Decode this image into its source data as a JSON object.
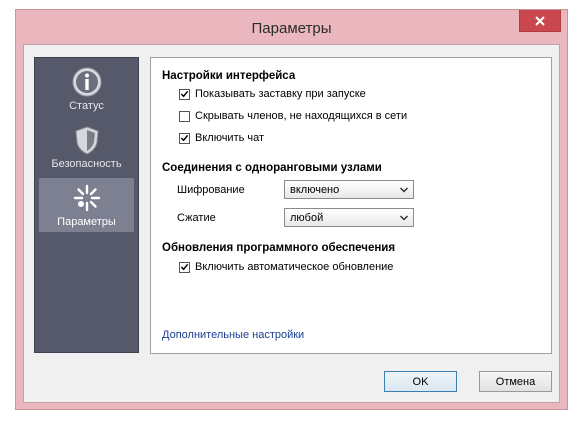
{
  "window": {
    "title": "Параметры"
  },
  "sidebar": {
    "items": [
      {
        "label": "Статус",
        "icon": "info-icon"
      },
      {
        "label": "Безопасность",
        "icon": "shield-icon"
      },
      {
        "label": "Параметры",
        "icon": "settings-icon",
        "active": true
      }
    ]
  },
  "interface": {
    "title": "Настройки интерфейса",
    "options": [
      {
        "label": "Показывать заставку при запуске",
        "checked": true
      },
      {
        "label": "Скрывать членов, не находящихся в сети",
        "checked": false
      },
      {
        "label": "Включить чат",
        "checked": true
      }
    ]
  },
  "peers": {
    "title": "Соединения с одноранговыми узлами",
    "encryption_label": "Шифрование",
    "encryption_value": "включено",
    "compression_label": "Сжатие",
    "compression_value": "любой"
  },
  "updates": {
    "title": "Обновления программного обеспечения",
    "auto_update_label": "Включить автоматическое обновление",
    "auto_update_checked": true
  },
  "advanced_link": "Дополнительные настройки",
  "buttons": {
    "ok": "OK",
    "cancel": "Отмена"
  }
}
